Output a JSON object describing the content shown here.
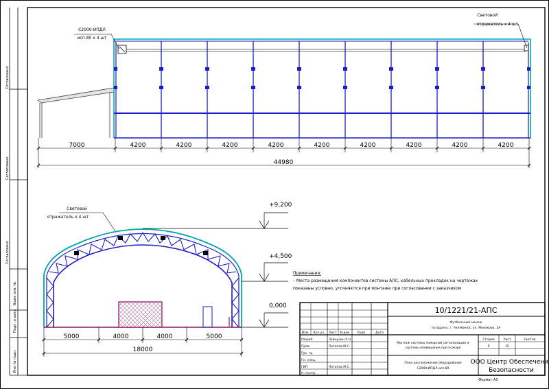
{
  "top_view": {
    "callout_left": [
      "С2000-ИПДЛ",
      "исп.80 х 4 шт"
    ],
    "callout_right": [
      "Световой",
      "отражатель х 4 шт"
    ],
    "dimensions": [
      "7000",
      "4200",
      "4200",
      "4200",
      "4200",
      "4200",
      "4200",
      "4200",
      "4200",
      "4200"
    ],
    "total": "44980"
  },
  "section_view": {
    "callout": [
      "Световой",
      "отражатель х 4 шт"
    ],
    "levels": [
      "+9,200",
      "+4,500",
      "0,000"
    ],
    "dimensions": [
      "5000",
      "4000",
      "4000",
      "5000"
    ],
    "total": "18000"
  },
  "notes": {
    "title": "Примечания:",
    "lines": [
      "– Места размещения компонентов системы АПС, кабельных прокладок на чертежах",
      "показаны условно, уточняются при монтаже при согласовании с заказчиком"
    ]
  },
  "title_block": {
    "doc_code": "10/1221/21-АПС",
    "object": [
      "Футбольный манеж",
      "по адресу: г. Челябинск, ул. Монакова, 1А"
    ],
    "system": [
      "Монтаж системы пожарной сигнализации и",
      "системы оповещения при пожаре"
    ],
    "sheet_title": [
      "План расположения оборудования",
      "С2000-ИПДЛ исп.80"
    ],
    "company": [
      "ООО Центр Обеспечения",
      "Безопасности"
    ],
    "header_cols": [
      "Изм.",
      "Кол.уч.",
      "Лист",
      "N док.",
      "Подп.",
      "Дата"
    ],
    "roles": [
      "Разраб.",
      "Пров.",
      "Рук. гр.",
      "Гл. спец.",
      "ГИП",
      "Н. контр."
    ],
    "names": [
      "Зайнулин Р.Н.",
      "Потапов М.С.",
      "",
      "",
      "Потапов М.С.",
      ""
    ],
    "stage_label": "Стадия",
    "sheet_label": "Лист",
    "sheets_label": "Листов",
    "stage": "Р",
    "sheet": "15",
    "sheets": "",
    "format": "Формат А3"
  },
  "side_stamp": [
    "Согласовано",
    "Согласовано",
    "Согласовано",
    "Взам. инв. №",
    "Подп. и дата",
    "Инв. № подл."
  ]
}
